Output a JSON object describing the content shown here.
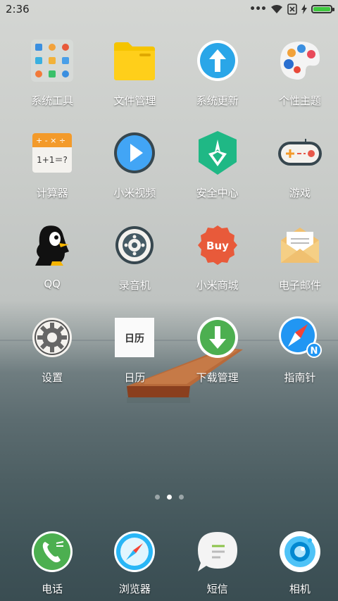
{
  "status_bar": {
    "time": "2:36",
    "battery_percent": 100
  },
  "apps": [
    {
      "id": "system-tools",
      "label": "系统工具",
      "icon": "tools-folder-icon"
    },
    {
      "id": "file-manager",
      "label": "文件管理",
      "icon": "folder-icon"
    },
    {
      "id": "system-update",
      "label": "系统更新",
      "icon": "update-arrow-icon"
    },
    {
      "id": "themes",
      "label": "个性主题",
      "icon": "palette-icon"
    },
    {
      "id": "calculator",
      "label": "计算器",
      "icon": "calculator-icon",
      "text": "1+1＝?"
    },
    {
      "id": "mi-video",
      "label": "小米视频",
      "icon": "play-icon"
    },
    {
      "id": "security",
      "label": "安全中心",
      "icon": "shield-icon"
    },
    {
      "id": "games",
      "label": "游戏",
      "icon": "gamepad-icon"
    },
    {
      "id": "qq",
      "label": "QQ",
      "icon": "penguin-icon"
    },
    {
      "id": "recorder",
      "label": "录音机",
      "icon": "recorder-icon"
    },
    {
      "id": "mi-store",
      "label": "小米商城",
      "icon": "buy-badge-icon",
      "text": "Buy"
    },
    {
      "id": "email",
      "label": "电子邮件",
      "icon": "envelope-icon"
    },
    {
      "id": "settings",
      "label": "设置",
      "icon": "gear-icon"
    },
    {
      "id": "calendar",
      "label": "日历",
      "icon": "calendar-icon",
      "text": "日历"
    },
    {
      "id": "downloads",
      "label": "下载管理",
      "icon": "download-arrow-icon"
    },
    {
      "id": "compass",
      "label": "指南针",
      "icon": "compass-icon",
      "text": "N"
    }
  ],
  "dock": [
    {
      "id": "phone",
      "label": "电话",
      "icon": "phone-icon"
    },
    {
      "id": "browser",
      "label": "浏览器",
      "icon": "browser-compass-icon"
    },
    {
      "id": "messages",
      "label": "短信",
      "icon": "message-bubble-icon"
    },
    {
      "id": "camera",
      "label": "相机",
      "icon": "camera-lens-icon"
    }
  ],
  "pages": {
    "count": 3,
    "current": 2
  }
}
